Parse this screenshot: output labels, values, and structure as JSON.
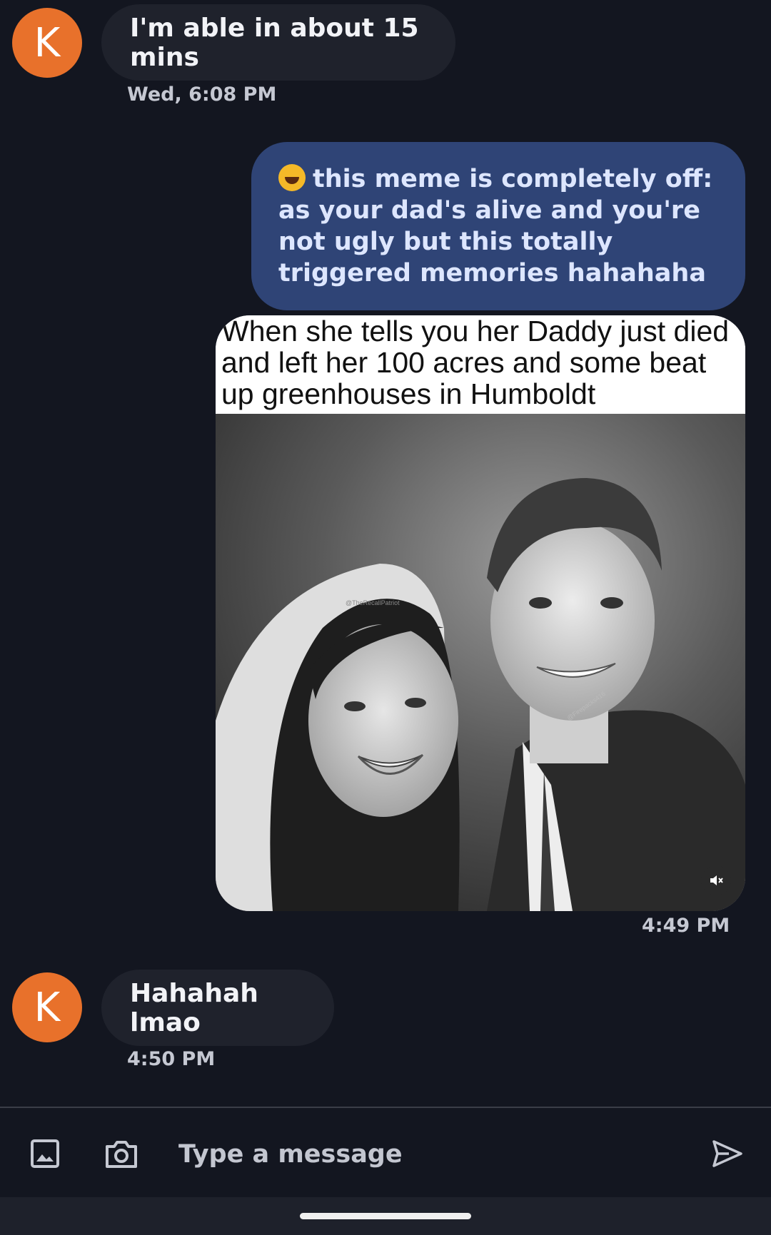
{
  "messages": [
    {
      "sender_initial": "K",
      "text": "I'm able in about 15 mins",
      "time": "Wed, 6:08 PM"
    },
    {
      "outgoing_text": "this meme is completely off: as your dad's alive and you're not ugly but this totally triggered memories hahahaha",
      "emoji": "rolling-on-floor-laughing-emoji"
    },
    {
      "meme_caption": "When she tells you her Daddy just died and left her 100 acres and some beat up greenhouses in Humboldt",
      "watermark_1": "@TheRecallPatriot",
      "watermark_2": "@Firepacks416",
      "time": "4:49 PM"
    },
    {
      "sender_initial": "K",
      "text": "Hahahah lmao",
      "time": "4:50 PM"
    }
  ],
  "composer": {
    "placeholder": "Type a message",
    "gallery_icon": "image-icon",
    "camera_icon": "camera-icon",
    "send_icon": "send-icon"
  },
  "colors": {
    "background": "#131620",
    "avatar": "#e8712b",
    "incoming_bubble": "#1f222c",
    "outgoing_bubble": "#2f4476"
  }
}
